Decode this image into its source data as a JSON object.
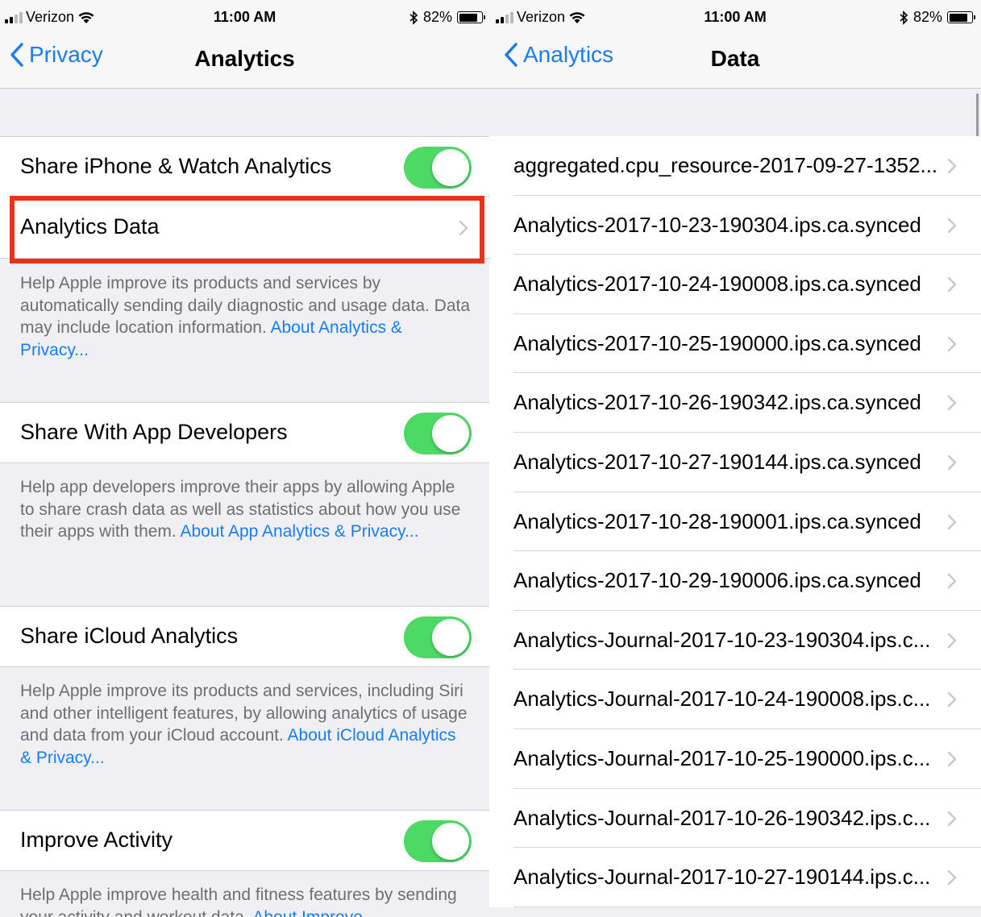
{
  "left": {
    "status": {
      "carrier": "Verizon",
      "time": "11:00 AM",
      "battery": "82%"
    },
    "nav": {
      "back_label": "Privacy",
      "title": "Analytics"
    },
    "share_iphone": {
      "label": "Share iPhone & Watch Analytics"
    },
    "analytics_data": {
      "label": "Analytics Data"
    },
    "footer1": {
      "text": "Help Apple improve its products and services by automatically sending daily diagnostic and usage data. Data may include location information. ",
      "link": "About Analytics & Privacy..."
    },
    "share_dev": {
      "label": "Share With App Developers"
    },
    "footer2": {
      "text": "Help app developers improve their apps by allowing Apple to share crash data as well as statistics about how you use their apps with them. ",
      "link": "About App Analytics & Privacy..."
    },
    "share_icloud": {
      "label": "Share iCloud Analytics"
    },
    "footer3": {
      "text": "Help Apple improve its products and services, including Siri and other intelligent features, by allowing analytics of usage and data from your iCloud account. ",
      "link": "About iCloud Analytics & Privacy..."
    },
    "improve_activity": {
      "label": "Improve Activity"
    },
    "footer4": {
      "text": "Help Apple improve health and fitness features by sending your activity and workout data. ",
      "link": "About Improve"
    }
  },
  "right": {
    "status": {
      "carrier": "Verizon",
      "time": "11:00 AM",
      "battery": "82%"
    },
    "nav": {
      "back_label": "Analytics",
      "title": "Data"
    },
    "files": [
      "aggregated.cpu_resource-2017-09-27-1352...",
      "Analytics-2017-10-23-190304.ips.ca.synced",
      "Analytics-2017-10-24-190008.ips.ca.synced",
      "Analytics-2017-10-25-190000.ips.ca.synced",
      "Analytics-2017-10-26-190342.ips.ca.synced",
      "Analytics-2017-10-27-190144.ips.ca.synced",
      "Analytics-2017-10-28-190001.ips.ca.synced",
      "Analytics-2017-10-29-190006.ips.ca.synced",
      "Analytics-Journal-2017-10-23-190304.ips.c...",
      "Analytics-Journal-2017-10-24-190008.ips.c...",
      "Analytics-Journal-2017-10-25-190000.ips.c...",
      "Analytics-Journal-2017-10-26-190342.ips.c...",
      "Analytics-Journal-2017-10-27-190144.ips.c..."
    ]
  },
  "colors": {
    "accent": "#1a7cf5",
    "toggle_on": "#4cd964",
    "highlight": "#e8321e"
  },
  "toggles": {
    "share_iphone": true,
    "share_dev": true,
    "share_icloud": true,
    "improve_activity": true
  }
}
